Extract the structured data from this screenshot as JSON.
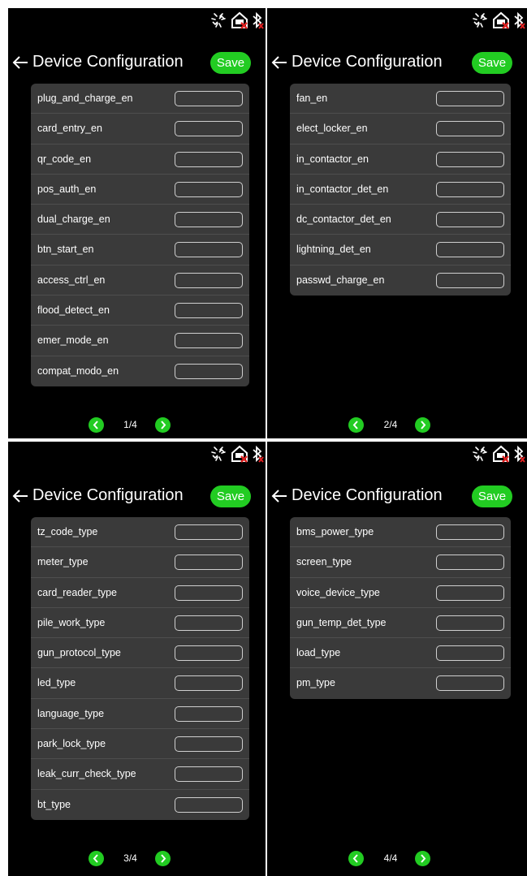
{
  "common": {
    "title": "Device Configuration",
    "save_label": "Save",
    "accent": "#22cc22",
    "status_icons": [
      "network-disconnected-icon",
      "cloud-error-icon",
      "bluetooth-off-icon"
    ]
  },
  "panels": [
    {
      "page": "1/4",
      "fields": [
        {
          "label": "plug_and_charge_en",
          "value": ""
        },
        {
          "label": "card_entry_en",
          "value": ""
        },
        {
          "label": "qr_code_en",
          "value": ""
        },
        {
          "label": "pos_auth_en",
          "value": ""
        },
        {
          "label": "dual_charge_en",
          "value": ""
        },
        {
          "label": "btn_start_en",
          "value": ""
        },
        {
          "label": "access_ctrl_en",
          "value": ""
        },
        {
          "label": "flood_detect_en",
          "value": ""
        },
        {
          "label": "emer_mode_en",
          "value": ""
        },
        {
          "label": "compat_modo_en",
          "value": ""
        }
      ]
    },
    {
      "page": "2/4",
      "fields": [
        {
          "label": "fan_en",
          "value": ""
        },
        {
          "label": "elect_locker_en",
          "value": ""
        },
        {
          "label": "in_contactor_en",
          "value": ""
        },
        {
          "label": "in_contactor_det_en",
          "value": ""
        },
        {
          "label": "dc_contactor_det_en",
          "value": ""
        },
        {
          "label": "lightning_det_en",
          "value": ""
        },
        {
          "label": "passwd_charge_en",
          "value": ""
        }
      ]
    },
    {
      "page": "3/4",
      "fields": [
        {
          "label": "tz_code_type",
          "value": ""
        },
        {
          "label": "meter_type",
          "value": ""
        },
        {
          "label": "card_reader_type",
          "value": ""
        },
        {
          "label": "pile_work_type",
          "value": ""
        },
        {
          "label": "gun_protocol_type",
          "value": ""
        },
        {
          "label": "led_type",
          "value": ""
        },
        {
          "label": "language_type",
          "value": ""
        },
        {
          "label": "park_lock_type",
          "value": ""
        },
        {
          "label": "leak_curr_check_type",
          "value": ""
        },
        {
          "label": "bt_type",
          "value": ""
        }
      ]
    },
    {
      "page": "4/4",
      "fields": [
        {
          "label": "bms_power_type",
          "value": ""
        },
        {
          "label": "screen_type",
          "value": ""
        },
        {
          "label": "voice_device_type",
          "value": ""
        },
        {
          "label": "gun_temp_det_type",
          "value": ""
        },
        {
          "label": "load_type",
          "value": ""
        },
        {
          "label": "pm_type",
          "value": ""
        }
      ]
    }
  ]
}
